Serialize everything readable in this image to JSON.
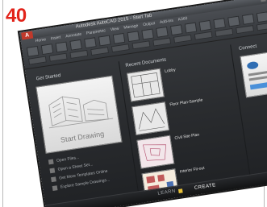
{
  "page": {
    "number": "40"
  },
  "window": {
    "title": "Autodesk AutoCAD 2015 - Start Tab"
  },
  "ribbon": {
    "tabs": [
      "Home",
      "Insert",
      "Annotate",
      "Parametric",
      "View",
      "Manage",
      "Output",
      "Add-ins",
      "A360"
    ]
  },
  "panels": {
    "get_started": "Get Started",
    "recent_documents": "Recent Documents",
    "connect": "Connect"
  },
  "start_card": {
    "label": "Start Drawing"
  },
  "start_links": [
    "Open Files...",
    "Open a Sheet Set...",
    "Get More Templates Online",
    "Explore Sample Drawings..."
  ],
  "recent": [
    {
      "name": "Lobby"
    },
    {
      "name": "Floor Plan-Sample"
    },
    {
      "name": "Civil Site Plan"
    },
    {
      "name": "Interior Fit-out"
    }
  ],
  "bottom": {
    "learn": "LEARN",
    "create": "CREATE"
  },
  "colors": {
    "accent_red": "#e2231a",
    "app_red": "#c0392b",
    "learn_yellow": "#e8c23a"
  }
}
